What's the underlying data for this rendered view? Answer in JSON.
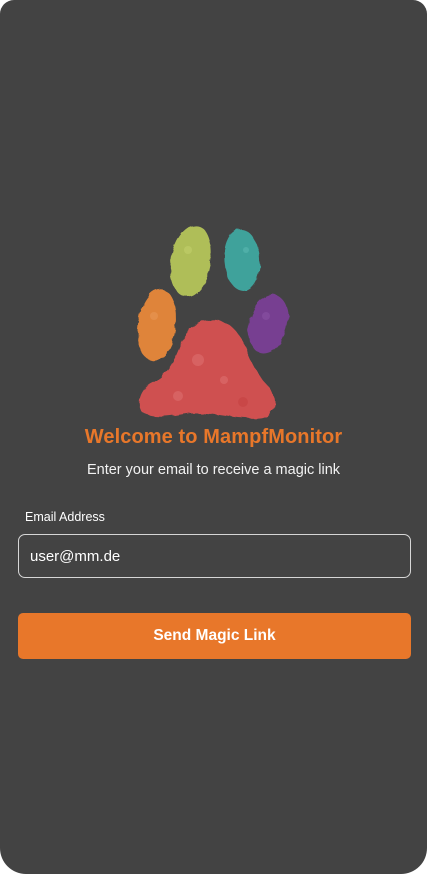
{
  "app": {
    "title": "Welcome to MampfMonitor",
    "subtitle": "Enter your email to receive a magic link",
    "logo_icon": "paw-print-icon"
  },
  "login_form": {
    "email_label": "Email Address",
    "email_value": "user@mm.de",
    "submit_label": "Send Magic Link"
  },
  "colors": {
    "background": "#434343",
    "accent": "#e8772a",
    "paw_pad": "#d65151",
    "toe_orange": "#e8883a",
    "toe_green": "#b5c45a",
    "toe_teal": "#3fa7a0",
    "toe_purple": "#7a3f96"
  }
}
